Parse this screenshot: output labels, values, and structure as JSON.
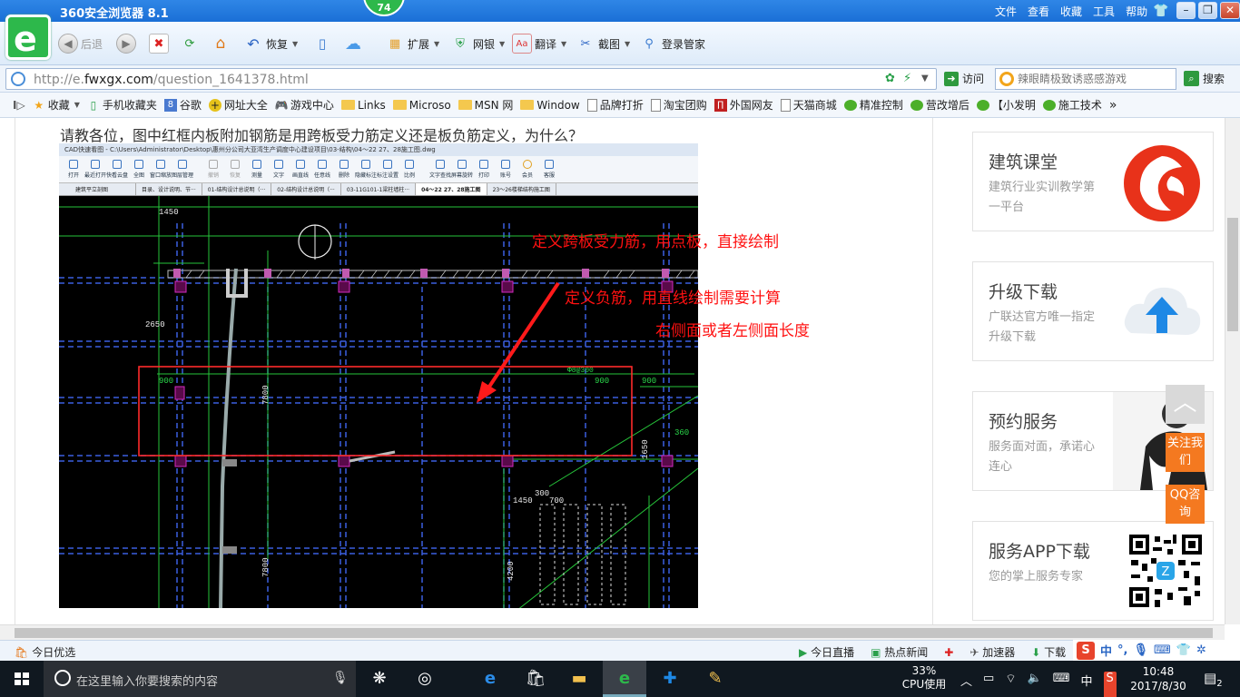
{
  "browser": {
    "title": "360安全浏览器 8.1",
    "badge": "74",
    "menus": [
      "文件",
      "查看",
      "收藏",
      "工具",
      "帮助"
    ],
    "toolbar": {
      "back": "后退",
      "restore": "恢复",
      "extend": "扩展",
      "netbank": "网银",
      "translate": "翻译",
      "screenshot": "截图",
      "login": "登录管家"
    },
    "url": {
      "prefix": "http://e.",
      "host": "fwxgx.com",
      "path": "/question_1641378.html"
    },
    "visit": "访问",
    "search_placeholder": "辣眼睛极致诱惑感游戏",
    "search_label": "搜索",
    "bookmarks": [
      "收藏",
      "手机收藏夹",
      "谷歌",
      "网址大全",
      "游戏中心",
      "Links",
      "Microso",
      "MSN 网",
      "Window",
      "品牌打折",
      "淘宝团购",
      "外国网友",
      "天猫商城",
      "精准控制",
      "营改增后",
      "【小发明",
      "施工技术"
    ],
    "more": "»"
  },
  "page": {
    "question": "请教各位，图中红框内板附加钢筋是用跨板受力筋定义还是板负筋定义，为什么？"
  },
  "cad": {
    "title": "CAD快速看图 - C:\\Users\\Administrator\\Desktop\\惠州分公司大亚湾生产调度中心建设项目\\03-结构\\04～22 27、28施工图.dwg",
    "tools": [
      "打开",
      "最近打开",
      "快看云盘",
      "全图",
      "窗口缩放",
      "图层管理",
      "撤销",
      "恢复",
      "测量",
      "文字",
      "画直线",
      "任意线",
      "删除",
      "隐藏标注",
      "标注设置",
      "比例",
      "文字查找",
      "屏幕旋转",
      "打印",
      "账号",
      "会员",
      "客服"
    ],
    "tabs": [
      "建筑平立剖图",
      "目录、设计说明、节···",
      "01-结构设计总说明（···",
      "02-结构设计总说明（···",
      "03-11G101-1梁柱墙柱···",
      "04～22 27、28施工图",
      "23～26楼梯结构施工图"
    ],
    "dims": {
      "d1450a": "1450",
      "d2650": "2650",
      "d900a": "900",
      "d900b": "900",
      "d900c": "900",
      "d7800a": "7800",
      "d7800b": "7800",
      "d1650": "1650",
      "d1450b": "1450",
      "d300": "300",
      "d700": "700",
      "d4200": "4200",
      "rebar": "Φ8@300",
      "d360": "360"
    }
  },
  "annotations": {
    "line1": "定义跨板受力筋，用点板，直接绘制",
    "line2": "定义负筋，用直线绘制需要计算",
    "line3": "右侧面或者左侧面长度"
  },
  "sidebar": [
    {
      "title": "建筑课堂",
      "sub": "建筑行业实训教学第一平台"
    },
    {
      "title": "升级下载",
      "sub": "广联达官方唯一指定升级下载"
    },
    {
      "title": "预约服务",
      "sub": "服务面对面，承诺心连心"
    },
    {
      "title": "服务APP下载",
      "sub": "您的掌上服务专家"
    }
  ],
  "floating": {
    "top": "︿",
    "follow": "关注我们",
    "qq": "QQ咨询"
  },
  "statusbar": {
    "left": "今日优选",
    "live": "今日直播",
    "hot": "热点新闻",
    "accel": "加速器",
    "download": "下载"
  },
  "ime": {
    "lang": "中"
  },
  "taskbar": {
    "search_placeholder": "在这里输入你要搜索的内容",
    "cpu_percent": "33%",
    "cpu_label": "CPU使用",
    "input": "中",
    "time": "10:48",
    "date": "2017/8/30",
    "notifications": "2"
  },
  "colors": {
    "annotation": "#ff1a1a",
    "accent_orange": "#f47920",
    "browser_green": "#2db84b",
    "title_blue": "#1a6fd6"
  }
}
